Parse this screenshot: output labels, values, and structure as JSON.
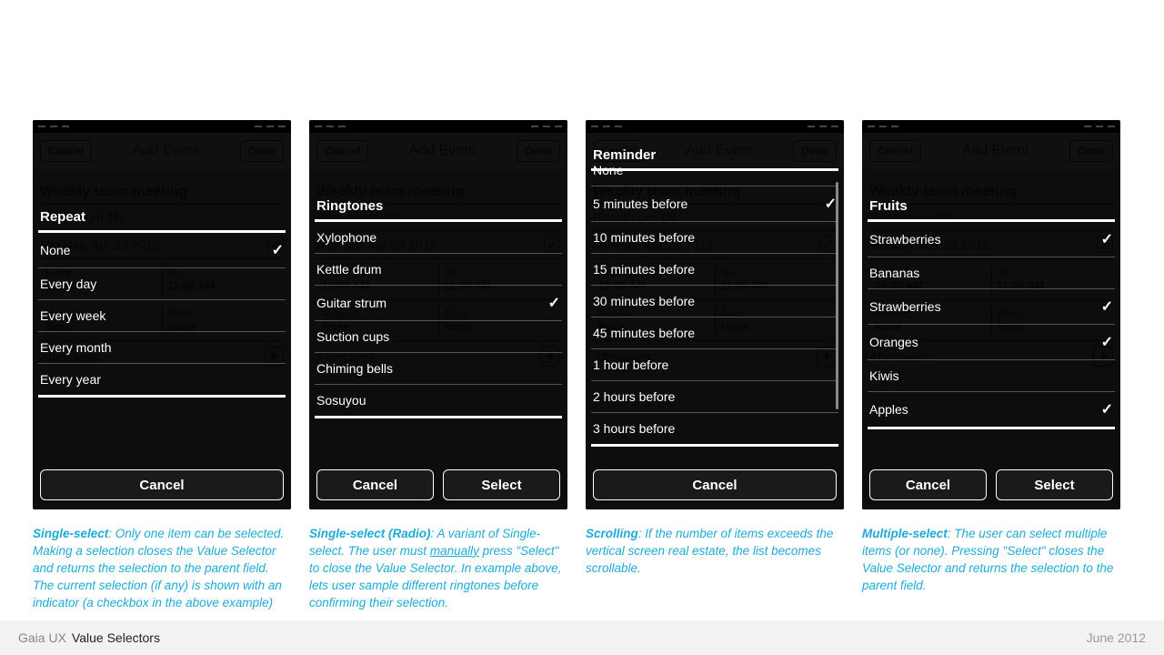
{
  "ghost": {
    "cancel": "Cancel",
    "done": "Done",
    "title": "Add Event",
    "event_title": "Weekly team meeting",
    "location": "Boardroom TN",
    "date_row": "Monday, Apr 23 2012",
    "from_label": "From:",
    "from_value": "10:00 AM",
    "to_label": "To:",
    "to_value": "11:00 AM",
    "repeat_label": "Repeat:",
    "repeat_value": "None",
    "alert_label": "Alert:",
    "alert_value": "None",
    "attendees_label": "Attendees:"
  },
  "phone1": {
    "title": "Repeat",
    "options": [
      {
        "label": "None",
        "checked": true
      },
      {
        "label": "Every day",
        "checked": false
      },
      {
        "label": "Every week",
        "checked": false
      },
      {
        "label": "Every month",
        "checked": false
      },
      {
        "label": "Every year",
        "checked": false
      }
    ],
    "cancel": "Cancel"
  },
  "phone2": {
    "title": "Ringtones",
    "options": [
      {
        "label": "Xylophone",
        "checked": false
      },
      {
        "label": "Kettle drum",
        "checked": false
      },
      {
        "label": "Guitar strum",
        "checked": true
      },
      {
        "label": "Suction cups",
        "checked": false
      },
      {
        "label": "Chiming bells",
        "checked": false
      },
      {
        "label": "Sosuyou",
        "checked": false
      }
    ],
    "cancel": "Cancel",
    "select": "Select"
  },
  "phone3": {
    "title": "Reminder",
    "options": [
      {
        "label": "None",
        "checked": false
      },
      {
        "label": "5 minutes before",
        "checked": true
      },
      {
        "label": "10 minutes before",
        "checked": false
      },
      {
        "label": "15 minutes before",
        "checked": false
      },
      {
        "label": "30 minutes before",
        "checked": false
      },
      {
        "label": "45 minutes before",
        "checked": false
      },
      {
        "label": "1 hour before",
        "checked": false
      },
      {
        "label": "2 hours before",
        "checked": false
      },
      {
        "label": "3 hours before",
        "checked": false
      }
    ],
    "cancel": "Cancel"
  },
  "phone4": {
    "title": "Fruits",
    "options": [
      {
        "label": "Strawberries",
        "checked": true
      },
      {
        "label": "Bananas",
        "checked": false
      },
      {
        "label": "Strawberries",
        "checked": true
      },
      {
        "label": "Oranges",
        "checked": true
      },
      {
        "label": "Kiwis",
        "checked": false
      },
      {
        "label": "Apples",
        "checked": true
      }
    ],
    "cancel": "Cancel",
    "select": "Select"
  },
  "captions": {
    "c1_b": "Single-select",
    "c1": ": Only one item can be selected. Making a selection closes the Value Selector and returns the selection to the parent field. The current selection (if any) is shown with an indicator (a checkbox in the above example)",
    "c2_b": "Single-select (Radio)",
    "c2a": ": A variant of Single-select. The user must ",
    "c2u": "manually",
    "c2b": " press \"Select\" to close the Value Selector. In example above, lets user sample different ringtones before confirming their selection.",
    "c3_b": "Scrolling",
    "c3": ": If the number of items exceeds the vertical screen real estate, the list becomes scrollable.",
    "c4_b": "Multiple-select",
    "c4": ": The user can select multiple items (or none). Pressing \"Select\" closes the Value Selector and returns the selection to the parent field."
  },
  "footer": {
    "brand": "Gaia UX",
    "page": "Value Selectors",
    "date": "June 2012"
  }
}
